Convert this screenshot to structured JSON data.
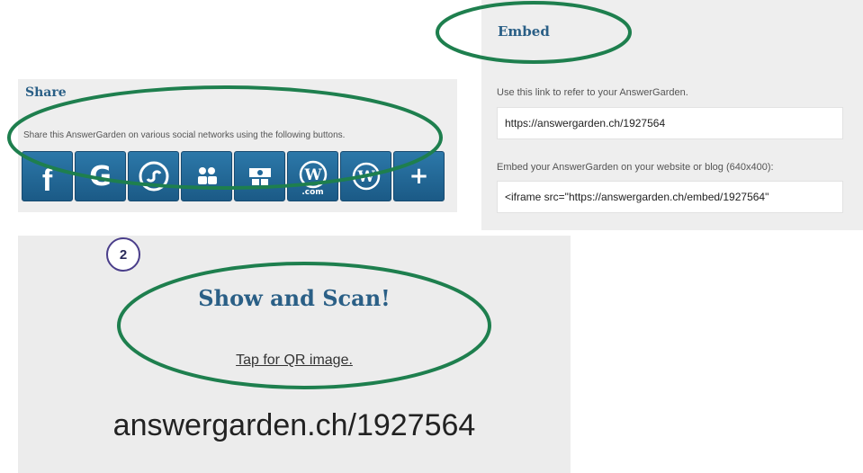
{
  "share": {
    "title": "Share",
    "description": "Share this AnswerGarden on various social networks using the following buttons.",
    "buttons": [
      {
        "name": "facebook",
        "glyph": "f"
      },
      {
        "name": "google",
        "glyph": "G"
      },
      {
        "name": "stumbleupon",
        "glyph": "su"
      },
      {
        "name": "ms-teams",
        "glyph": "teams"
      },
      {
        "name": "classroom",
        "glyph": "classroom"
      },
      {
        "name": "wordpress-com",
        "glyph": "W",
        "sub": ".com"
      },
      {
        "name": "wordpress",
        "glyph": "W"
      },
      {
        "name": "more",
        "glyph": "+"
      }
    ],
    "button_color": "#1f6799"
  },
  "embed": {
    "title": "Embed",
    "link_label": "Use this link to refer to your AnswerGarden.",
    "link_value": "https://answergarden.ch/1927564",
    "embed_label": "Embed your AnswerGarden on your website or blog (640x400):",
    "embed_value": "<iframe src=\"https://answergarden.ch/embed/1927564\""
  },
  "scan": {
    "title": "Show and Scan!",
    "qr_link": "Tap for QR image.",
    "url": "answergarden.ch/1927564"
  },
  "annotations": {
    "step_number": "2",
    "ring_color": "#1e7f4e"
  }
}
